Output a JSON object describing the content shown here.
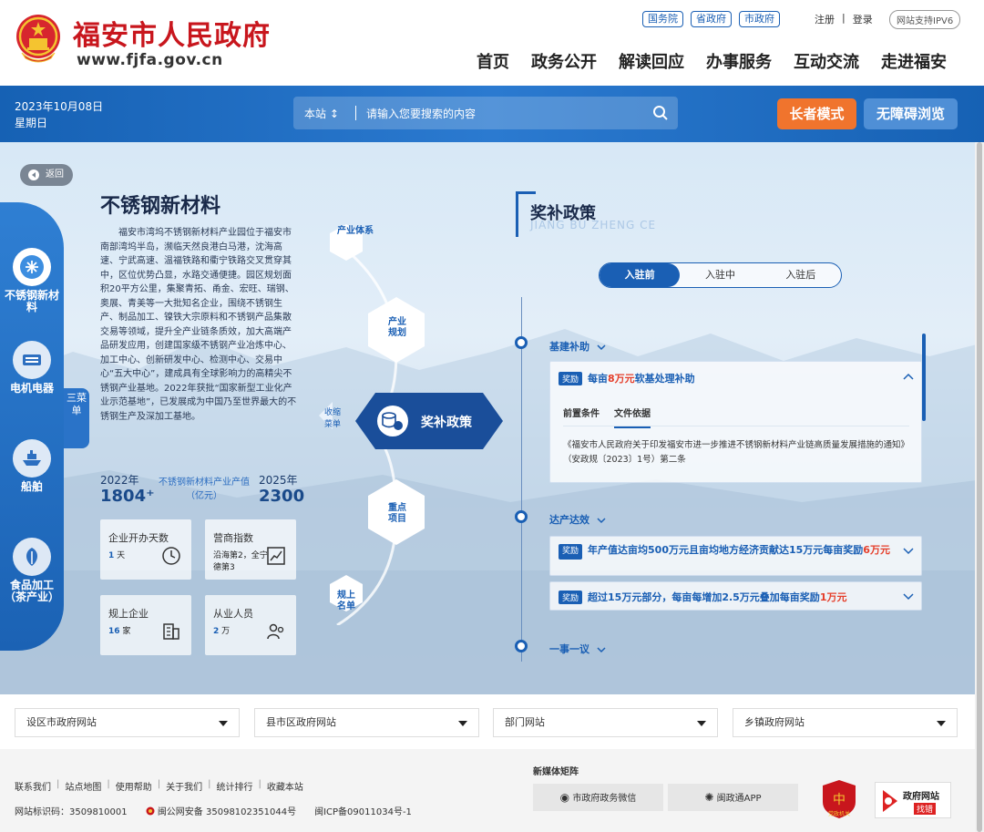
{
  "header": {
    "site_title": "福安市人民政府",
    "site_url": "www.fjfa.gov.cn",
    "gov_links": [
      "国务院",
      "省政府",
      "市政府"
    ],
    "register": "注册",
    "login": "登录",
    "ipv6": "网站支持IPV6",
    "nav": [
      "首页",
      "政务公开",
      "解读回应",
      "办事服务",
      "互动交流",
      "走进福安"
    ]
  },
  "bluebar": {
    "date": "2023年10月08日",
    "weekday": "星期日",
    "search_scope": "本站",
    "search_placeholder": "请输入您要搜索的内容",
    "elder_mode": "长者模式",
    "accessible": "无障碍浏览"
  },
  "main": {
    "back": "返回",
    "sidebar": [
      {
        "label": "不锈钢新材料",
        "icon": "steel-icon"
      },
      {
        "label": "电机电器",
        "icon": "motor-icon"
      },
      {
        "label": "船舶",
        "icon": "ship-icon"
      },
      {
        "label": "食品加工（茶产业）",
        "icon": "leaf-icon"
      }
    ],
    "menu_tab": "三菜单",
    "title": "不锈钢新材料",
    "intro": "福安市湾坞不锈钢新材料产业园位于福安市南部湾坞半岛，濒临天然良港白马港，沈海高速、宁武高速、温福铁路和衢宁铁路交叉贯穿其中，区位优势凸显，水路交通便捷。园区规划面积20平方公里，集聚青拓、甬金、宏旺、瑞钢、奥展、青美等一大批知名企业，围绕不锈钢生产、制品加工、镍铁大宗原料和不锈钢产品集散交易等领域，提升全产业链条质效，加大高端产品研发应用，创建国家级不锈钢产业冶炼中心、加工中心、创新研发中心、检测中心、交易中心“五大中心”，建成具有全球影响力的高精尖不锈钢产业基地。2022年获批“国家新型工业化产业示范基地”，已发展成为中国乃至世界最大的不锈钢生产及深加工基地。",
    "stats": {
      "year1": "2022年",
      "value1": "1804⁺",
      "mid": "不锈钢新材料产业产值（亿元）",
      "year2": "2025年",
      "value2": "2300"
    },
    "cards": [
      {
        "label": "企业开办天数",
        "value_num": "1",
        "value_unit": "天",
        "icon": "clock-icon"
      },
      {
        "label": "营商指数",
        "value_text": "沿海第2，全宁德第3",
        "icon": "chart-icon"
      },
      {
        "label": "规上企业",
        "value_num": "16",
        "value_unit": "家",
        "icon": "building-icon"
      },
      {
        "label": "从业人员",
        "value_num": "2",
        "value_unit": "万",
        "icon": "people-icon"
      }
    ],
    "chain": {
      "items": [
        "产业体系",
        "产业规划",
        "奖补政策",
        "重点项目",
        "规上名单"
      ],
      "collapse": "收缩菜单"
    }
  },
  "policy": {
    "title": "奖补政策",
    "subtitle": "JIANG BU ZHENG CE",
    "tabs": [
      "入驻前",
      "入驻中",
      "入驻后"
    ],
    "groups": [
      {
        "name": "基建补助",
        "items": [
          {
            "badge": "奖励",
            "pre": "每亩",
            "highlight": "8万元",
            "post": "软基处理补助",
            "sub_tabs": [
              "前置条件",
              "文件依据"
            ],
            "doc": "《福安市人民政府关于印发福安市进一步推进不锈钢新材料产业链高质量发展措施的通知》（安政规〔2023〕1号）第二条"
          }
        ]
      },
      {
        "name": "达产达效",
        "items": [
          {
            "badge": "奖励",
            "pre": "年产值达亩均500万元且亩均地方经济贡献达15万元每亩奖励",
            "highlight": "6万元",
            "post": ""
          },
          {
            "badge": "奖励",
            "pre": "超过15万元部分，每亩每增加2.5万元叠加每亩奖励",
            "highlight": "1万元",
            "post": ""
          }
        ]
      },
      {
        "name": "一事一议",
        "items": []
      }
    ]
  },
  "footer": {
    "selects": [
      "设区市政府网站",
      "县市区政府网站",
      "部门网站",
      "乡镇政府网站"
    ],
    "links": [
      "联系我们",
      "站点地图",
      "使用帮助",
      "关于我们",
      "统计排行",
      "收藏本站"
    ],
    "site_id": "网站标识码：3509810001",
    "police": "闽公网安备 35098102351044号",
    "icp": "闽ICP备09011034号-1",
    "media_title": "新媒体矩阵",
    "media": [
      "市政府政务微信",
      "闽政通APP"
    ],
    "badge1": "党政机关",
    "badge2_title": "政府网站",
    "badge2_sub": "找错"
  },
  "colors": {
    "brand_red": "#c8161d",
    "primary_blue": "#1a5fb4",
    "accent_orange": "#f0742d"
  }
}
